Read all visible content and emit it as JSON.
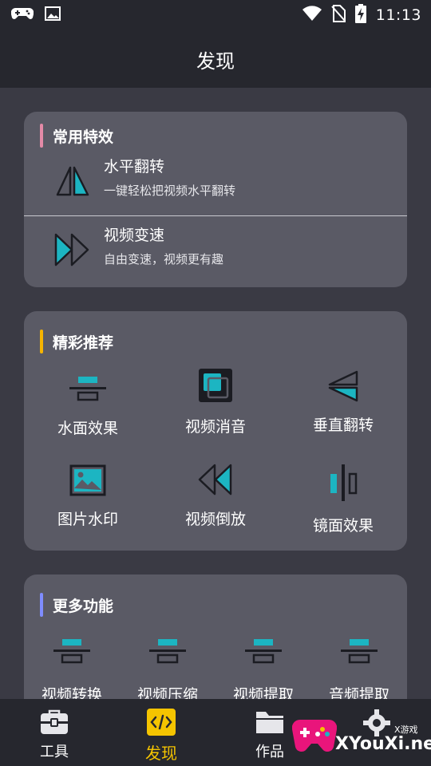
{
  "status_bar": {
    "time": "11:13"
  },
  "header": {
    "title": "发现"
  },
  "common_effects": {
    "title": "常用特效",
    "accent": "#e48aa7",
    "items": [
      {
        "icon": "flip-horizontal-icon",
        "title": "水平翻转",
        "subtitle": "一键轻松把视频水平翻转"
      },
      {
        "icon": "fast-forward-icon",
        "title": "视频变速",
        "subtitle": "自由变速，视频更有趣"
      }
    ]
  },
  "featured": {
    "title": "精彩推荐",
    "accent": "#f5b400",
    "items": [
      {
        "icon": "water-reflection-icon",
        "label": "水面效果"
      },
      {
        "icon": "mute-video-icon",
        "label": "视频消音"
      },
      {
        "icon": "flip-vertical-icon",
        "label": "垂直翻转"
      },
      {
        "icon": "image-watermark-icon",
        "label": "图片水印"
      },
      {
        "icon": "rewind-icon",
        "label": "视频倒放"
      },
      {
        "icon": "mirror-effect-icon",
        "label": "镜面效果"
      }
    ]
  },
  "more": {
    "title": "更多功能",
    "accent": "#7f8cff",
    "items": [
      {
        "icon": "convert-icon",
        "label": "视频转换"
      },
      {
        "icon": "compress-icon",
        "label": "视频压缩"
      },
      {
        "icon": "extract-video-icon",
        "label": "视频提取"
      },
      {
        "icon": "extract-audio-icon",
        "label": "音频提取"
      }
    ]
  },
  "tabs": [
    {
      "icon": "toolbox-icon",
      "label": "工具",
      "active": false
    },
    {
      "icon": "code-icon",
      "label": "发现",
      "active": true
    },
    {
      "icon": "folder-icon",
      "label": "作品",
      "active": false
    },
    {
      "icon": "gear-icon",
      "label": "",
      "active": false
    }
  ],
  "watermark": {
    "text": "XYouXi.net",
    "small": "X游戏"
  },
  "colors": {
    "cyan": "#1cb5c2",
    "active_tab": "#f5c400"
  }
}
